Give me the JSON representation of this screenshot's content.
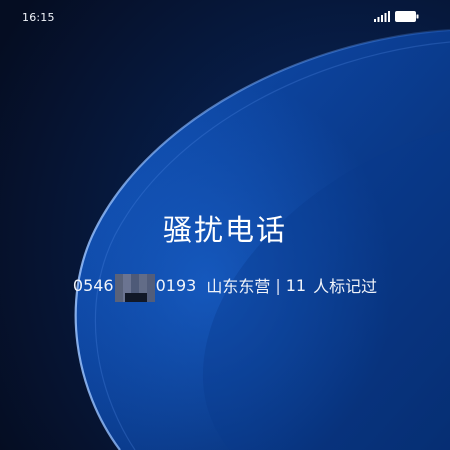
{
  "status_bar": {
    "time": "16:15",
    "icons": [
      "signal-icon",
      "battery-icon"
    ]
  },
  "incoming_call": {
    "title": "骚扰电话",
    "number_prefix": "0546",
    "number_suffix": "0193",
    "location": "山东东营",
    "separator": "|",
    "marked_count": "11",
    "marked_label": "人标记过"
  },
  "colors": {
    "background_dark": "#061029",
    "wave_blue": "#0b47a8",
    "text": "#ffffff"
  }
}
